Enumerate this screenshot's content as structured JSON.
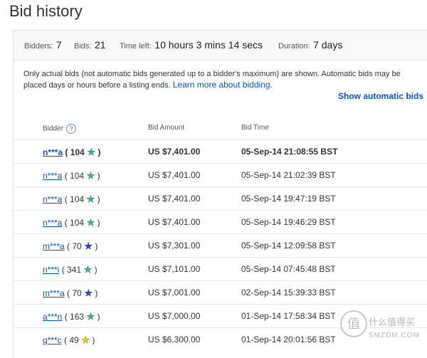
{
  "page": {
    "title": "Bid history"
  },
  "summary": {
    "bidders_label": "Bidders:",
    "bidders_value": "7",
    "bids_label": "Bids:",
    "bids_value": "21",
    "time_left_label": "Time left:",
    "time_left_value": "10 hours 3 mins 14 secs",
    "duration_label": "Duration:",
    "duration_value": "7 days"
  },
  "note": {
    "text": "Only actual bids (not automatic bids generated up to a bidder's maximum) are shown. Automatic bids may be placed days or hours before a listing ends.",
    "link": "Learn more about bidding."
  },
  "show_automatic_bids": "Show automatic bids",
  "table": {
    "headers": {
      "bidder": "Bidder",
      "help": "?",
      "amount": "Bid Amount",
      "time": "Bid Time"
    },
    "rows": [
      {
        "name": "n***a",
        "score": "104",
        "star": "teal",
        "amount": "US $7,401.00",
        "time": "05-Sep-14 21:08:55 BST"
      },
      {
        "name": "n***a",
        "score": "104",
        "star": "teal",
        "amount": "US $7,401.00",
        "time": "05-Sep-14 21:02:39 BST"
      },
      {
        "name": "n***a",
        "score": "104",
        "star": "teal",
        "amount": "US $7,401.00",
        "time": "05-Sep-14 19:47:19 BST"
      },
      {
        "name": "n***a",
        "score": "104",
        "star": "teal",
        "amount": "US $7,401.00",
        "time": "05-Sep-14 19:46:29 BST"
      },
      {
        "name": "m***a",
        "score": "70",
        "star": "blue",
        "amount": "US $7,301.00",
        "time": "05-Sep-14 12:09:58 BST"
      },
      {
        "name": "n***i",
        "score": "341",
        "star": "teal",
        "amount": "US $7,101.00",
        "time": "05-Sep-14 07:45:48 BST"
      },
      {
        "name": "m***a",
        "score": "70",
        "star": "blue",
        "amount": "US $7,001.00",
        "time": "02-Sep-14 15:39:33 BST"
      },
      {
        "name": "a***n",
        "score": "163",
        "star": "teal",
        "amount": "US $7,000.00",
        "time": "01-Sep-14 17:58:34 BST"
      },
      {
        "name": "q***c",
        "score": "49",
        "star": "yellow",
        "amount": "US $6,300.00",
        "time": "01-Sep-14 20:01:56 BST"
      }
    ]
  },
  "watermark": {
    "cn": "什么值得买",
    "en": "SMZDM.COM"
  },
  "colors": {
    "link": "#0654ba",
    "star_teal": "#3fb5a3",
    "star_blue": "#2a4fc8",
    "star_yellow": "#f0d020"
  }
}
